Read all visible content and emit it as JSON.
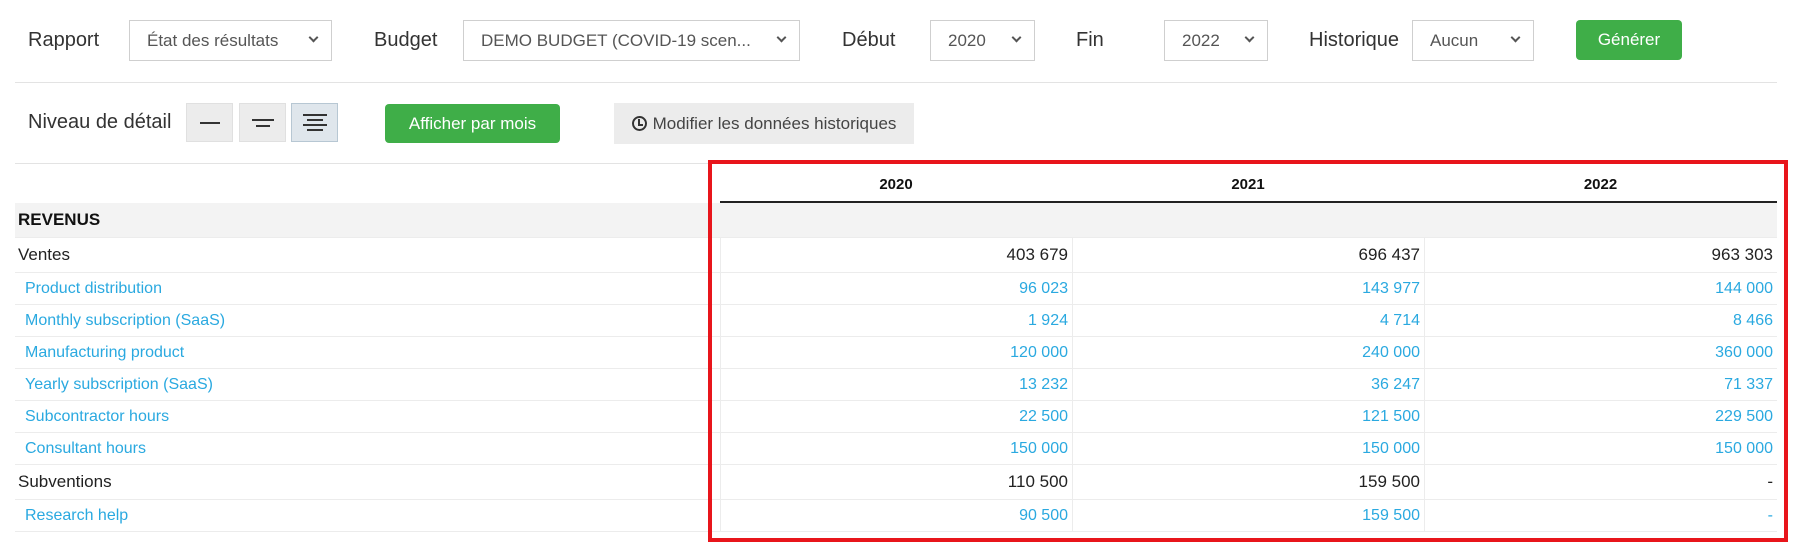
{
  "filters": {
    "rapport_label": "Rapport",
    "rapport_value": "État des résultats",
    "budget_label": "Budget",
    "budget_value": "DEMO BUDGET (COVID-19 scen...",
    "debut_label": "Début",
    "debut_value": "2020",
    "fin_label": "Fin",
    "fin_value": "2022",
    "historique_label": "Historique",
    "historique_value": "Aucun",
    "generate_label": "Générer"
  },
  "detail": {
    "label": "Niveau de détail",
    "level_icons": [
      "level-1-icon",
      "level-2-icon",
      "level-3-icon"
    ],
    "active_level": 3,
    "monthly_button": "Afficher par mois",
    "history_button": "Modifier les données historiques"
  },
  "table": {
    "years": [
      "2020",
      "2021",
      "2022"
    ],
    "section": "REVENUS",
    "rows": [
      {
        "label": "Ventes",
        "kind": "main",
        "values": [
          "403 679",
          "696 437",
          "963 303"
        ]
      },
      {
        "label": "Product distribution",
        "kind": "sub",
        "values": [
          "96 023",
          "143 977",
          "144 000"
        ]
      },
      {
        "label": "Monthly subscription (SaaS)",
        "kind": "sub",
        "values": [
          "1 924",
          "4 714",
          "8 466"
        ]
      },
      {
        "label": "Manufacturing product",
        "kind": "sub",
        "values": [
          "120 000",
          "240 000",
          "360 000"
        ]
      },
      {
        "label": "Yearly subscription (SaaS)",
        "kind": "sub",
        "values": [
          "13 232",
          "36 247",
          "71 337"
        ]
      },
      {
        "label": "Subcontractor hours",
        "kind": "sub",
        "values": [
          "22 500",
          "121 500",
          "229 500"
        ]
      },
      {
        "label": "Consultant hours",
        "kind": "sub",
        "values": [
          "150 000",
          "150 000",
          "150 000"
        ]
      },
      {
        "label": "Subventions",
        "kind": "main",
        "values": [
          "110 500",
          "159 500",
          "-"
        ]
      },
      {
        "label": "Research help",
        "kind": "sub",
        "values": [
          "90 500",
          "159 500",
          "-"
        ]
      }
    ]
  },
  "colors": {
    "accent_green": "#3fae48",
    "link_blue": "#2aa9e0",
    "highlight_red": "#e8151b"
  }
}
